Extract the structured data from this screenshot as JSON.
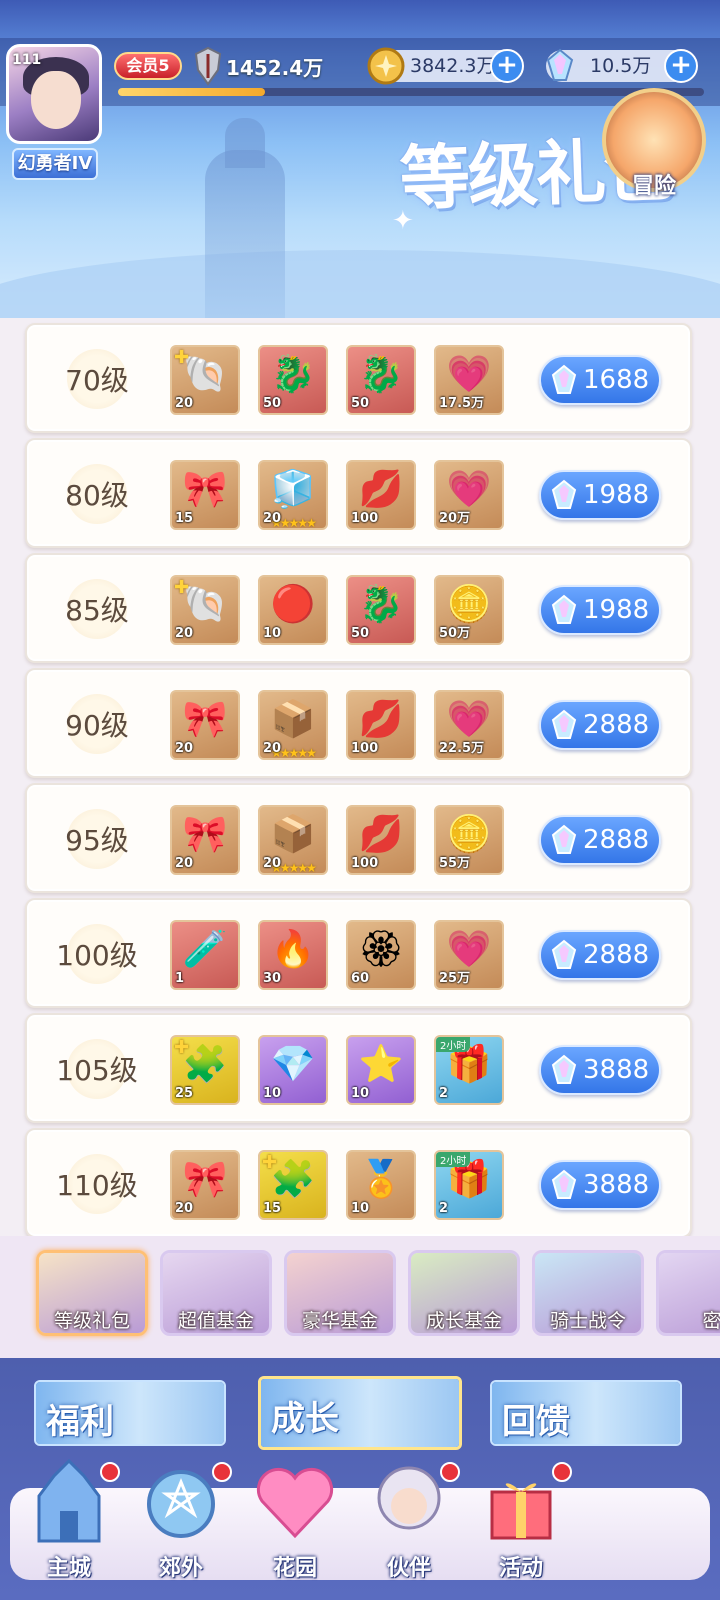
{
  "player": {
    "level": "111",
    "title_badge": "幻勇者IV",
    "vip": "会员5",
    "power": "1452.4万",
    "exp_progress": 0.25
  },
  "resources": {
    "coins": "3842.3万",
    "gems": "10.5万",
    "coin_icon": "gold-coin-icon",
    "gem_icon": "crystal-gem-icon"
  },
  "page": {
    "title": "等级礼包"
  },
  "packs": [
    {
      "level": "70级",
      "price": "1688",
      "items": [
        {
          "icon": "shell-fragment-icon",
          "qty": "20",
          "color": "brown",
          "glyph": "🐚",
          "puzzle": true
        },
        {
          "icon": "gold-dragon-icon",
          "qty": "50",
          "color": "red",
          "glyph": "🐉"
        },
        {
          "icon": "gold-dragon-icon",
          "qty": "50",
          "color": "red",
          "glyph": "🐉"
        },
        {
          "icon": "exp-heart-icon",
          "qty": "17.5万",
          "color": "brown",
          "glyph": "💗"
        }
      ]
    },
    {
      "level": "80级",
      "price": "1988",
      "items": [
        {
          "icon": "pink-ribbon-icon",
          "qty": "15",
          "color": "brown",
          "glyph": "🎀"
        },
        {
          "icon": "supply-box-icon",
          "qty": "20",
          "color": "brown",
          "glyph": "🧊",
          "stars": "★★★★★"
        },
        {
          "icon": "lips-token-icon",
          "qty": "100",
          "color": "brown",
          "glyph": "💋"
        },
        {
          "icon": "exp-heart-icon",
          "qty": "20万",
          "color": "brown",
          "glyph": "💗"
        }
      ]
    },
    {
      "level": "85级",
      "price": "1988",
      "items": [
        {
          "icon": "shell-fragment-icon",
          "qty": "20",
          "color": "brown",
          "glyph": "🐚",
          "puzzle": true
        },
        {
          "icon": "dragon-orb-icon",
          "qty": "10",
          "color": "brown",
          "glyph": "🔴"
        },
        {
          "icon": "gold-dragon-icon",
          "qty": "50",
          "color": "red",
          "glyph": "🐉"
        },
        {
          "icon": "gold-coin-icon",
          "qty": "50万",
          "color": "brown",
          "glyph": "🪙"
        }
      ]
    },
    {
      "level": "90级",
      "price": "2888",
      "items": [
        {
          "icon": "pink-ribbon-icon",
          "qty": "20",
          "color": "brown",
          "glyph": "🎀"
        },
        {
          "icon": "supply-box-icon",
          "qty": "20",
          "color": "brown",
          "glyph": "📦",
          "stars": "★★★★★"
        },
        {
          "icon": "lips-token-icon",
          "qty": "100",
          "color": "brown",
          "glyph": "💋"
        },
        {
          "icon": "exp-heart-icon",
          "qty": "22.5万",
          "color": "brown",
          "glyph": "💗"
        }
      ]
    },
    {
      "level": "95级",
      "price": "2888",
      "items": [
        {
          "icon": "pink-ribbon-icon",
          "qty": "20",
          "color": "brown",
          "glyph": "🎀"
        },
        {
          "icon": "supply-box-icon",
          "qty": "20",
          "color": "brown",
          "glyph": "📦",
          "stars": "★★★★★"
        },
        {
          "icon": "lips-token-icon",
          "qty": "100",
          "color": "brown",
          "glyph": "💋"
        },
        {
          "icon": "gold-coin-icon",
          "qty": "55万",
          "color": "brown",
          "glyph": "🪙"
        }
      ]
    },
    {
      "level": "100级",
      "price": "2888",
      "items": [
        {
          "icon": "rainbow-potion-icon",
          "qty": "1",
          "color": "red",
          "glyph": "🧪"
        },
        {
          "icon": "flame-emblem-icon",
          "qty": "30",
          "color": "red",
          "glyph": "🔥"
        },
        {
          "icon": "flame-medal-icon",
          "qty": "60",
          "color": "brown",
          "glyph": "🏵"
        },
        {
          "icon": "exp-heart-icon",
          "qty": "25万",
          "color": "brown",
          "glyph": "💗"
        }
      ]
    },
    {
      "level": "105级",
      "price": "3888",
      "items": [
        {
          "icon": "gold-fragment-icon",
          "qty": "25",
          "color": "gold",
          "glyph": "🧩",
          "puzzle": true
        },
        {
          "icon": "crystal-orb-icon",
          "qty": "10",
          "color": "purple",
          "glyph": "💎"
        },
        {
          "icon": "purple-star-icon",
          "qty": "10",
          "color": "purple",
          "glyph": "⭐"
        },
        {
          "icon": "treasure-chest-icon",
          "qty": "2",
          "color": "teal",
          "glyph": "🎁",
          "tag": "2小时"
        }
      ]
    },
    {
      "level": "110级",
      "price": "3888",
      "items": [
        {
          "icon": "pink-ribbon-icon",
          "qty": "20",
          "color": "brown",
          "glyph": "🎀"
        },
        {
          "icon": "gold-fragment-icon",
          "qty": "15",
          "color": "gold",
          "glyph": "🧩",
          "puzzle": true
        },
        {
          "icon": "gold-medal-icon",
          "qty": "10",
          "color": "brown",
          "glyph": "🏅"
        },
        {
          "icon": "treasure-chest-icon",
          "qty": "2",
          "color": "teal",
          "glyph": "🎁",
          "tag": "2小时"
        }
      ]
    }
  ],
  "tabs": [
    {
      "label": "等级礼包",
      "active": true,
      "color": "#f6e3c6"
    },
    {
      "label": "超值基金",
      "active": false,
      "color": "#e6d7f0"
    },
    {
      "label": "豪华基金",
      "active": false,
      "color": "#f4d2cf"
    },
    {
      "label": "成长基金",
      "active": false,
      "color": "#d9ecc2"
    },
    {
      "label": "骑士战令",
      "active": false,
      "color": "#c9e6f5"
    },
    {
      "label": "密",
      "active": false,
      "color": "#e3d6f2"
    }
  ],
  "categories": [
    {
      "label": "福利",
      "active": false
    },
    {
      "label": "成长",
      "active": true
    },
    {
      "label": "回馈",
      "active": false
    }
  ],
  "nav": [
    {
      "label": "主城",
      "icon": "castle-icon",
      "badge": true
    },
    {
      "label": "郊外",
      "icon": "portal-icon",
      "badge": true
    },
    {
      "label": "花园",
      "icon": "heart-garden-icon",
      "badge": false
    },
    {
      "label": "伙伴",
      "icon": "partner-icon",
      "badge": true
    },
    {
      "label": "活动",
      "icon": "gift-box-icon",
      "badge": true
    },
    {
      "label": "冒险",
      "icon": "compass-icon",
      "badge": false
    }
  ]
}
